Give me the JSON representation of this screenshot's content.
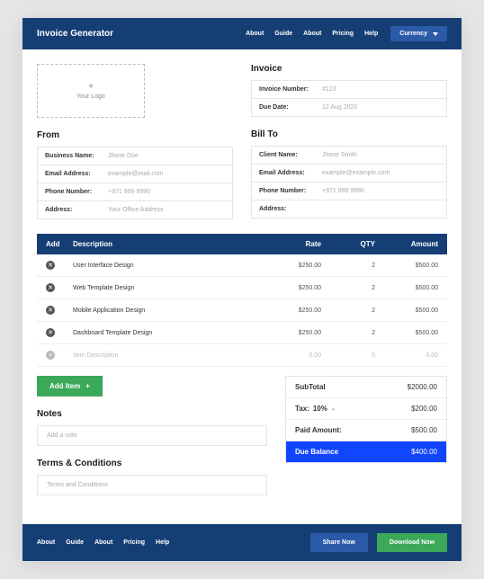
{
  "header": {
    "brand": "Invoice Generator",
    "nav": [
      "About",
      "Guide",
      "About",
      "Pricing",
      "Help"
    ],
    "currency": "Currency"
  },
  "logo": {
    "plus": "+",
    "label": "Your Logo"
  },
  "from": {
    "title": "From",
    "fields": [
      {
        "label": "Business Name:",
        "value": "Jhone Doe"
      },
      {
        "label": "Email Address:",
        "value": "example@mail.com"
      },
      {
        "label": "Phone Number:",
        "value": "+971 999 9990"
      },
      {
        "label": "Address:",
        "value": "Your Office Address"
      }
    ]
  },
  "invoice": {
    "title": "Invoice",
    "fields": [
      {
        "label": "Invoice Number:",
        "value": "#123"
      },
      {
        "label": "Due Date:",
        "value": "12 Aug 2020"
      }
    ]
  },
  "billto": {
    "title": "Bill To",
    "fields": [
      {
        "label": "Client Name:",
        "value": "Jhone Smith"
      },
      {
        "label": "Email Address:",
        "value": "example@example.com"
      },
      {
        "label": "Phone Number:",
        "value": "+971 999 9990"
      },
      {
        "label": "Address:",
        "value": ""
      }
    ]
  },
  "table": {
    "headers": {
      "add": "Add",
      "desc": "Description",
      "rate": "Rate",
      "qty": "QTY",
      "amt": "Amount"
    },
    "rows": [
      {
        "desc": "User Interface Design",
        "rate": "$250.00",
        "qty": "2",
        "amt": "$500.00"
      },
      {
        "desc": "Web Template Design",
        "rate": "$250.00",
        "qty": "2",
        "amt": "$500.00"
      },
      {
        "desc": "Mobile Application Design",
        "rate": "$250.00",
        "qty": "2",
        "amt": "$500.00"
      },
      {
        "desc": "Dashboard Template Design",
        "rate": "$250.00",
        "qty": "2",
        "amt": "$500.00"
      }
    ],
    "placeholder": {
      "desc": "Item Description",
      "rate": "0.00",
      "qty": "0",
      "amt": "0.00"
    }
  },
  "addItem": "Add Item",
  "notes": {
    "title": "Notes",
    "placeholder": "Add a note"
  },
  "terms": {
    "title": "Terms & Conditions",
    "placeholder": "Terms and Conditions"
  },
  "totals": {
    "subtotal": {
      "label": "SubTotal",
      "value": "$2000.00"
    },
    "tax": {
      "label": "Tax:",
      "pct": "10%",
      "value": "$200.00"
    },
    "paid": {
      "label": "Paid Amount:",
      "value": "$500.00"
    },
    "balance": {
      "label": "Due Balance",
      "value": "$400.00"
    }
  },
  "footer": {
    "nav": [
      "About",
      "Guide",
      "About",
      "Pricing",
      "Help"
    ],
    "share": "Share Now",
    "download": "Download Now"
  }
}
